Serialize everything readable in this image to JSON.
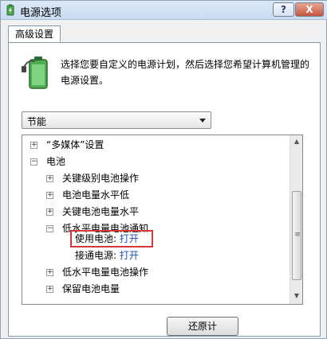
{
  "window": {
    "title": "电源选项",
    "help": "?",
    "close": "X"
  },
  "tab": {
    "label": "高级设置"
  },
  "description": "选择您要自定义的电源计划，然后选择您希望计算机管理的电源设置。",
  "plan_dropdown": {
    "selected": "节能"
  },
  "tree": {
    "items": [
      {
        "expander": "+",
        "label": "“多媒体”设置"
      },
      {
        "expander": "−",
        "label": "电池"
      },
      {
        "expander": "+",
        "label": "关键级别电池操作"
      },
      {
        "expander": "+",
        "label": "电池电量水平低"
      },
      {
        "expander": "+",
        "label": "关键电池电量水平"
      },
      {
        "expander": "−",
        "label": "低水平电量电池通知"
      },
      {
        "label": "使用电池:",
        "value": "打开"
      },
      {
        "label": "接通电源:",
        "value": "打开"
      },
      {
        "expander": "+",
        "label": "低水平电量电池操作"
      },
      {
        "expander": "+",
        "label": "保留电池电量"
      }
    ]
  },
  "buttons": {
    "restore": "还原计"
  },
  "colors": {
    "highlight": "#d23b3b",
    "value_link": "#1f4fb3"
  }
}
